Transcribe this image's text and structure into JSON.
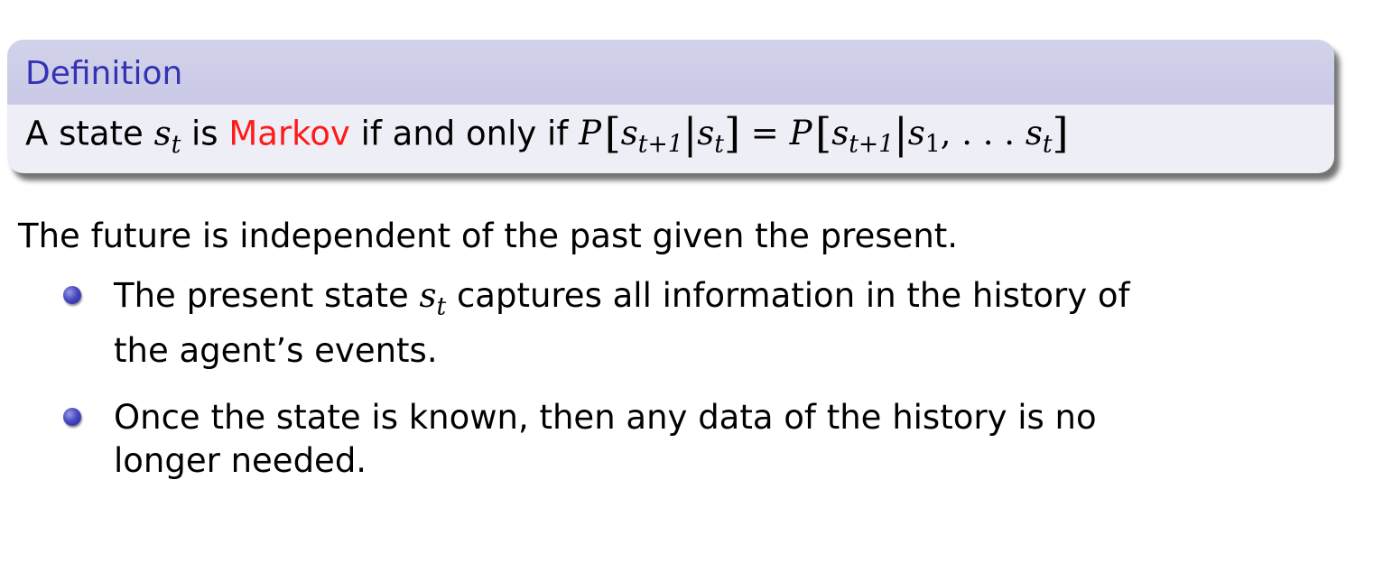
{
  "definition": {
    "title": "Definition",
    "statement": {
      "prefix": "A state ",
      "state_var": "s",
      "state_sub": "t",
      "mid1": " is ",
      "highlight": "Markov",
      "mid2": " if and only if ",
      "P": "P",
      "lbracket": "[",
      "rbracket": "]",
      "bar": "|",
      "eq": " = ",
      "sub_next": "t+1",
      "sub_one": "1",
      "comma_dots": ", . . . "
    },
    "colors": {
      "title_text": "#3333b3",
      "title_bg": "#c9c9e6",
      "body_bg": "#eeeef6",
      "highlight": "#ff1a1a"
    }
  },
  "lead_text": "The future is independent of the past given the present.",
  "bullets": [
    {
      "before": "The present state ",
      "var": "s",
      "sub": "t",
      "after_line1": " captures all information in the history of",
      "line2": "the agent’s events."
    },
    {
      "line1": "Once the state is known, then any data of the history is no",
      "line2": "longer needed."
    }
  ],
  "bullet_icon": "ball-bullet-icon"
}
